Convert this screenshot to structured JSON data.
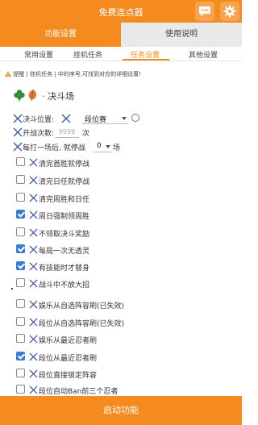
{
  "app": {
    "title": "免费连点器"
  },
  "titlebar": {
    "chat_icon": "chat-bubble-icon",
    "gear_icon": "gear-icon"
  },
  "main_tabs": [
    {
      "label": "功能设置",
      "active": true
    },
    {
      "label": "使用说明",
      "active": false
    }
  ],
  "sub_tabs": [
    {
      "label": "常用设置",
      "active": false
    },
    {
      "label": "挂机任务",
      "active": false
    },
    {
      "label": "任务设置",
      "active": true
    },
    {
      "label": "其他设置",
      "active": false
    }
  ],
  "notice": {
    "icon": "warning-icon",
    "text": "提醒 | 挂机任务 | 中的序号,可找到对应的详细设置!"
  },
  "section": {
    "icons": [
      "clover-icon",
      "leaf-icon"
    ],
    "label": "· 决斗场"
  },
  "settings": {
    "position_label": "决斗位置:",
    "position_value": "段位赛",
    "open_count_label": "开战次数:",
    "open_count_placeholder": "9999",
    "open_count_unit": "次",
    "every_label": "每打一场后, 就停战",
    "every_value": "0",
    "every_unit": "场"
  },
  "options_group1": [
    {
      "label": "清完首胜就停战",
      "checked": false
    },
    {
      "label": "清完日任就停战",
      "checked": false
    },
    {
      "label": "清完周胜和日任",
      "checked": false
    },
    {
      "label": "周日强制领周胜",
      "checked": true
    },
    {
      "label": "不领取决斗奖励",
      "checked": false
    },
    {
      "label": "每局一次无透灵",
      "checked": true
    },
    {
      "label": "有技能时才替身",
      "checked": true
    },
    {
      "label": "战斗中不放大招",
      "checked": false
    }
  ],
  "options_group2": [
    {
      "label": "娱乐从自选阵容刷(已失效)",
      "checked": false
    },
    {
      "label": "段位从自选阵容刷(已失效)",
      "checked": false
    },
    {
      "label": "娱乐从最近忍者刷",
      "checked": false
    },
    {
      "label": "段位从最近忍者刷",
      "checked": true
    },
    {
      "label": "段位直接锁定阵容",
      "checked": false
    },
    {
      "label": "段位自动Ban前三个忍者",
      "checked": false
    }
  ],
  "start_button": {
    "label": "启动功能"
  },
  "colors": {
    "accent": "#f58a1f",
    "check": "#3a7bd5",
    "x_mark": "#3a5aa8"
  }
}
